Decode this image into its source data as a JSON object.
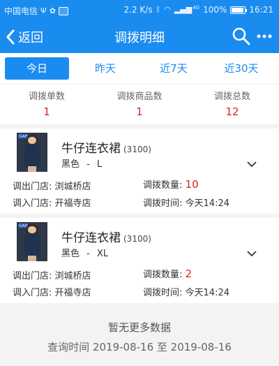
{
  "status_bar": {
    "carrier": "中国电信",
    "speed": "2.2 K/s",
    "battery": "100%",
    "time": "16:21",
    "network": "4G"
  },
  "nav": {
    "back_label": "返回",
    "title": "调拨明细",
    "icons": [
      "search-icon",
      "more-icon"
    ]
  },
  "tabs": [
    {
      "label": "今日",
      "active": true
    },
    {
      "label": "昨天",
      "active": false
    },
    {
      "label": "近7天",
      "active": false
    },
    {
      "label": "近30天",
      "active": false
    }
  ],
  "stats": [
    {
      "label": "调拨单数",
      "value": "1"
    },
    {
      "label": "调拨商品数",
      "value": "1"
    },
    {
      "label": "调拨总数",
      "value": "12"
    }
  ],
  "records": [
    {
      "name": "牛仔连衣裙",
      "code": "(3100)",
      "color": "黑色",
      "sep": "-",
      "size": "L",
      "out_label": "调出门店:",
      "out_store": "浏城桥店",
      "qty_label": "调拨数量:",
      "qty": "10",
      "in_label": "调入门店:",
      "in_store": "开福寺店",
      "time_label": "调拨时间:",
      "time": "今天14:24"
    },
    {
      "name": "牛仔连衣裙",
      "code": "(3100)",
      "color": "黑色",
      "sep": "-",
      "size": "XL",
      "out_label": "调出门店:",
      "out_store": "浏城桥店",
      "qty_label": "调拨数量:",
      "qty": "2",
      "in_label": "调入门店:",
      "in_store": "开福寺店",
      "time_label": "调拨时间:",
      "time": "今天14:24"
    }
  ],
  "footer": {
    "no_more": "暂无更多数据",
    "query_time": "查询时间 2019-08-16 至 2019-08-16"
  },
  "colors": {
    "primary": "#1a8cf0",
    "highlight": "#e02020",
    "background": "#f3f3f3"
  }
}
